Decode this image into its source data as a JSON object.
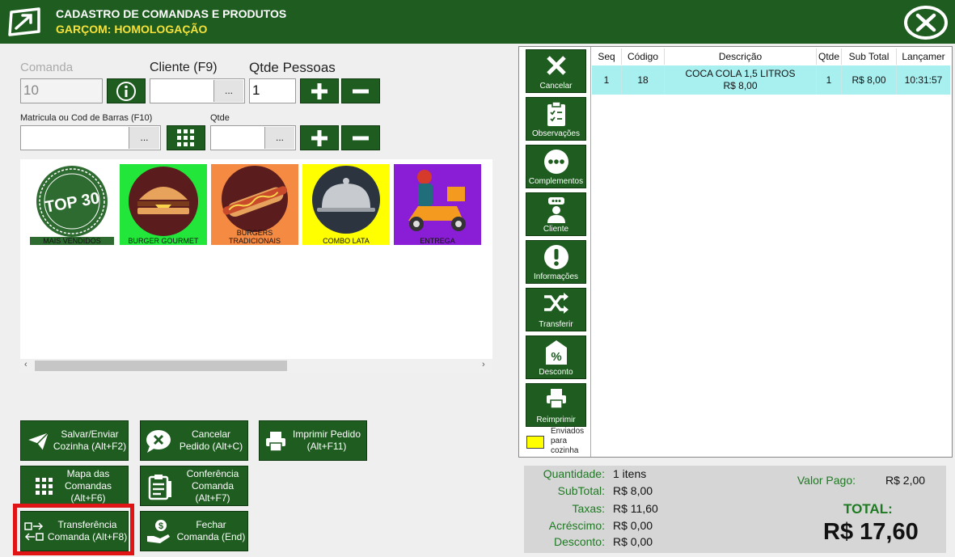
{
  "header": {
    "title": "CADASTRO DE COMANDAS E PRODUTOS",
    "subtitle": "GARÇOM: HOMOLOGAÇÃO"
  },
  "form": {
    "comanda_label": "Comanda",
    "comanda_value": "10",
    "cliente_label": "Cliente (F9)",
    "cliente_value": "",
    "pessoas_label": "Qtde Pessoas",
    "pessoas_value": "1",
    "matricula_label": "Matricula ou Cod de Barras (F10)",
    "matricula_value": "",
    "qtde_label": "Qtde",
    "qtde_value": "",
    "dots": "..."
  },
  "categories": [
    {
      "label": "MAIS VENDIDOS",
      "bg": "#ffffff"
    },
    {
      "label": "BURGER GOURMET",
      "bg": "#22e63a"
    },
    {
      "label": "BURGERS TRADICIONAIS",
      "bg": "#f58a43"
    },
    {
      "label": "COMBO LATA",
      "bg": "#ffff00"
    },
    {
      "label": "ENTREGA",
      "bg": "#8a1ed6"
    }
  ],
  "badge": "TOP 30",
  "actions": {
    "salvar": "Salvar/Enviar\nCozinha (Alt+F2)",
    "cancelar": "Cancelar\nPedido (Alt+C)",
    "imprimir": "Imprimir Pedido\n(Alt+F11)",
    "mapa": "Mapa das\nComandas\n(Alt+F6)",
    "conferencia": "Conferência\nComanda\n(Alt+F7)",
    "transferencia": "Transferência\nComanda (Alt+F8)",
    "fechar": "Fechar\nComanda (End)"
  },
  "sidebar": {
    "cancelar": "Cancelar",
    "observacoes": "Observações",
    "complementos": "Complementos",
    "cliente": "Cliente",
    "informacoes": "Informações",
    "transferir": "Transferir",
    "desconto": "Desconto",
    "reimprimir": "Reimprimir",
    "legend": "Enviados para cozinha"
  },
  "grid": {
    "headers": [
      "Seq",
      "Código",
      "Descrição",
      "Qtde",
      "Sub Total",
      "Lançamer"
    ],
    "rows": [
      {
        "seq": "1",
        "codigo": "18",
        "descricao": "COCA COLA 1,5 LITROS",
        "preco": "R$ 8,00",
        "qtde": "1",
        "subtotal": "R$ 8,00",
        "lancamento": "10:31:57"
      }
    ]
  },
  "totals": {
    "quantidade_label": "Quantidade:",
    "quantidade": "1 itens",
    "subtotal_label": "SubTotal:",
    "subtotal": "R$ 8,00",
    "taxas_label": "Taxas:",
    "taxas": "R$ 11,60",
    "acrescimo_label": "Acréscimo:",
    "acrescimo": "R$ 0,00",
    "desconto_label": "Desconto:",
    "desconto": "R$ 0,00",
    "valor_pago_label": "Valor Pago:",
    "valor_pago": "R$ 2,00",
    "total_label": "TOTAL:",
    "total": "R$ 17,60"
  },
  "colors": {
    "brand_green": "#1e5c20",
    "subtitle_yellow": "#f7e23a",
    "row_highlight": "#a8f0f0",
    "highlight_border": "#e01414"
  }
}
